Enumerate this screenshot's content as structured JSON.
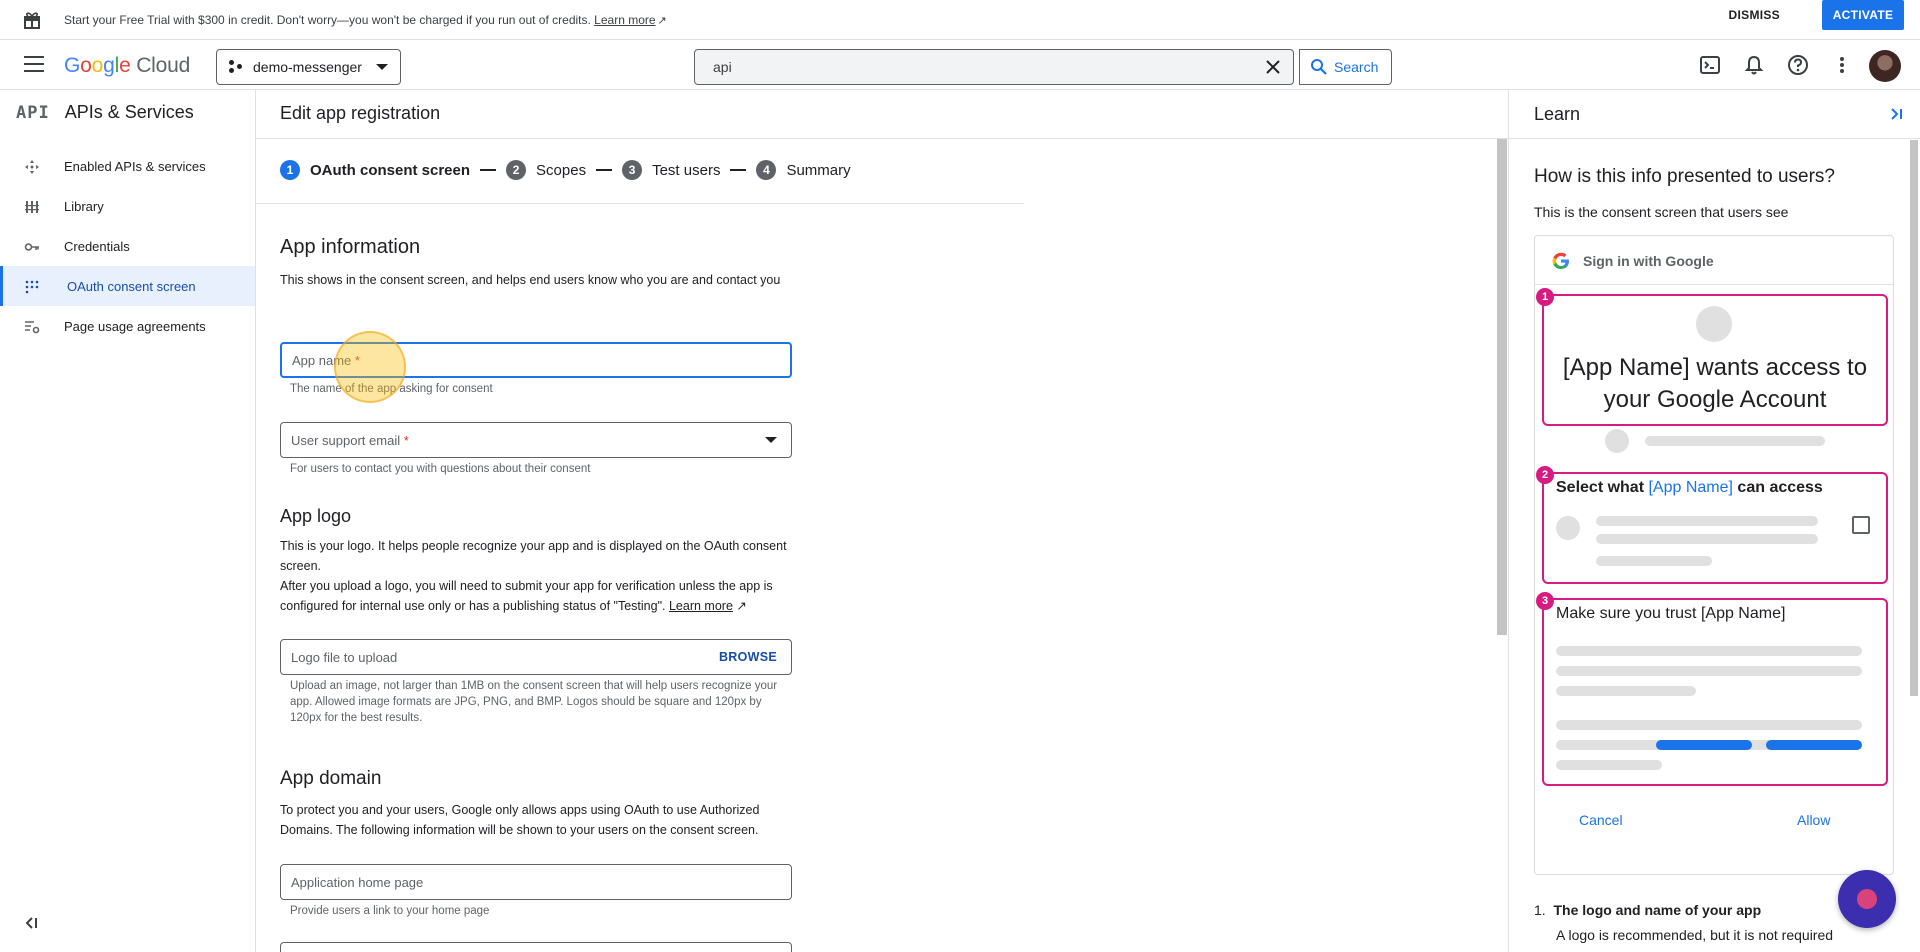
{
  "banner": {
    "message": "Start your Free Trial with $300 in credit. Don't worry—you won't be charged if you run out of credits.",
    "learn_more": "Learn more",
    "dismiss": "DISMISS",
    "activate": "ACTIVATE"
  },
  "header": {
    "logo_g": "Google",
    "logo_cloud": "Cloud",
    "project": "demo-messenger",
    "search_value": "api",
    "search_button": "Search"
  },
  "sidebar": {
    "badge": "API",
    "title": "APIs & Services",
    "items": [
      {
        "label": "Enabled APIs & services"
      },
      {
        "label": "Library"
      },
      {
        "label": "Credentials"
      },
      {
        "label": "OAuth consent screen"
      },
      {
        "label": "Page usage agreements"
      }
    ]
  },
  "main": {
    "title": "Edit app registration",
    "steps": [
      {
        "num": "1",
        "label": "OAuth consent screen"
      },
      {
        "num": "2",
        "label": "Scopes"
      },
      {
        "num": "3",
        "label": "Test users"
      },
      {
        "num": "4",
        "label": "Summary"
      }
    ],
    "app_info": {
      "heading": "App information",
      "desc": "This shows in the consent screen, and helps end users know who you are and contact you",
      "app_name_label": "App name",
      "req": "*",
      "app_name_helper": "The name of the app asking for consent",
      "email_label": "User support email",
      "email_helper": "For users to contact you with questions about their consent"
    },
    "app_logo": {
      "heading": "App logo",
      "desc1": "This is your logo. It helps people recognize your app and is displayed on the OAuth consent screen.",
      "desc2": "After you upload a logo, you will need to submit your app for verification unless the app is configured for internal use only or has a publishing status of \"Testing\".",
      "learn_more": "Learn more",
      "placeholder": "Logo file to upload",
      "browse": "BROWSE",
      "helper": "Upload an image, not larger than 1MB on the consent screen that will help users recognize your app. Allowed image formats are JPG, PNG, and BMP. Logos should be square and 120px by 120px for the best results."
    },
    "app_domain": {
      "heading": "App domain",
      "desc": "To protect you and your users, Google only allows apps using OAuth to use Authorized Domains. The following information will be shown to your users on the consent screen.",
      "home_placeholder": "Application home page",
      "home_helper": "Provide users a link to your home page"
    }
  },
  "learn": {
    "title": "Learn",
    "heading": "How is this info presented to users?",
    "sub": "This is the consent screen that users see",
    "mock": {
      "signin": "Sign in with Google",
      "box1_title": "[App Name] wants access to your Google Account",
      "box2_prefix": "Select what",
      "box2_app": "[App Name]",
      "box2_suffix": "can access",
      "box3_title": "Make sure you trust [App Name]",
      "badges": [
        "1",
        "2",
        "3"
      ],
      "cancel": "Cancel",
      "allow": "Allow"
    },
    "list_num": "1.",
    "list_title": "The logo and name of your app",
    "list_desc": "A logo is recommended, but it is not required"
  },
  "colors": {
    "accent": "#1a73e8",
    "highlight": "#d81b80"
  }
}
